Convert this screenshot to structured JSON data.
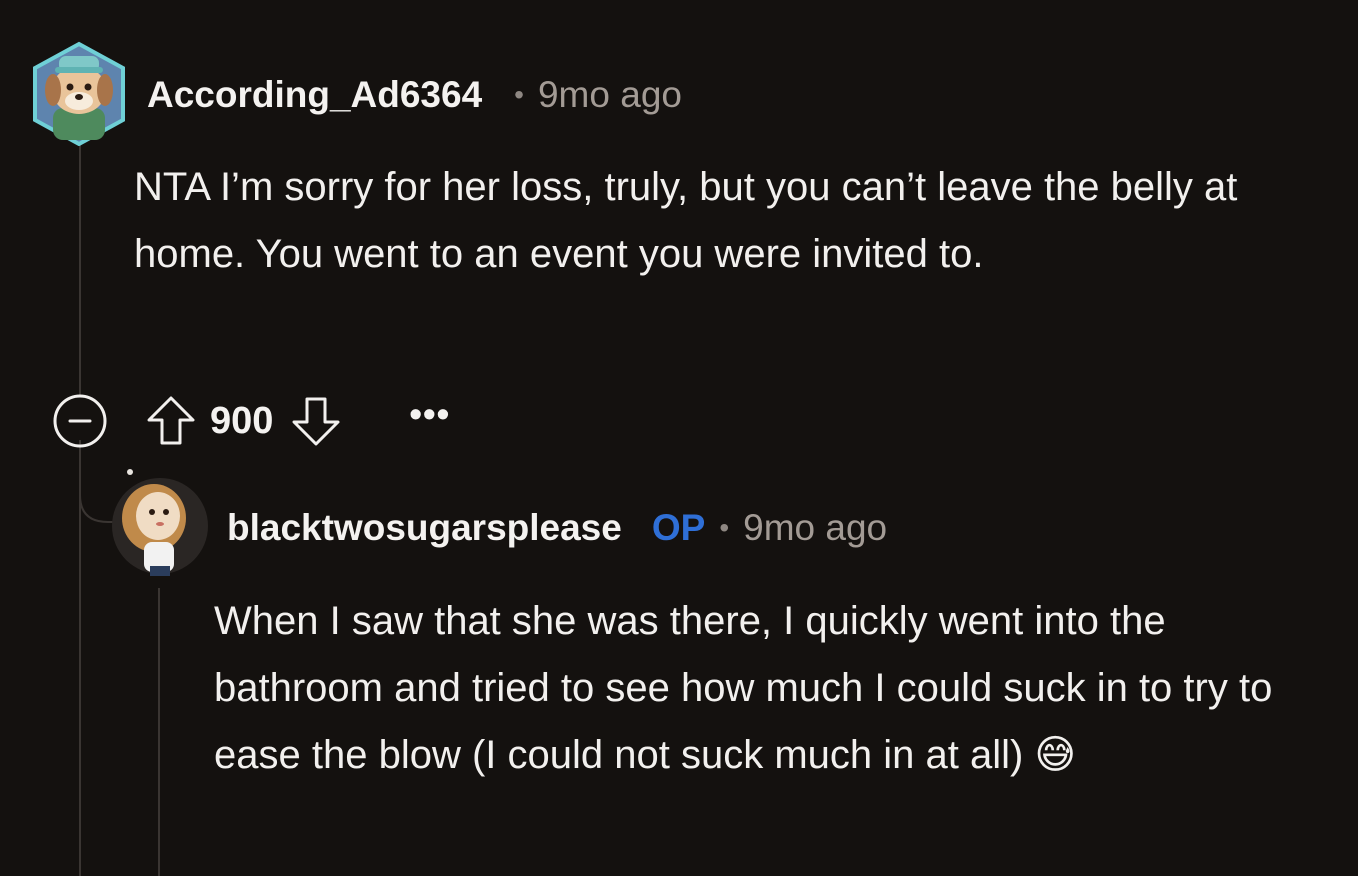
{
  "comment": {
    "username": "According_Ad6364",
    "separator": "•",
    "time": "9mo ago",
    "body": "NTA I’m sorry for her loss, truly, but you can’t leave the belly at home. You went to an event you were invited to.",
    "score": "900",
    "more": "•••",
    "icons": {
      "collapse": "collapse-minus-icon",
      "upvote": "upvote-arrow-icon",
      "downvote": "downvote-arrow-icon",
      "more": "more-options-icon"
    }
  },
  "reply": {
    "username": "blacktwosugarsplease",
    "op_badge": "OP",
    "separator": "•",
    "time": "9mo ago",
    "body": "When I saw that she was there, I quickly went into the bathroom and tried to see how much I could suck in to try to ease the blow (I could not suck much in at all) 😅"
  },
  "colors": {
    "background": "#14110f",
    "text": "#f2f0ee",
    "muted": "#a39b95",
    "op_badge": "#2f6fd6",
    "thread_line": "#3a3532"
  }
}
